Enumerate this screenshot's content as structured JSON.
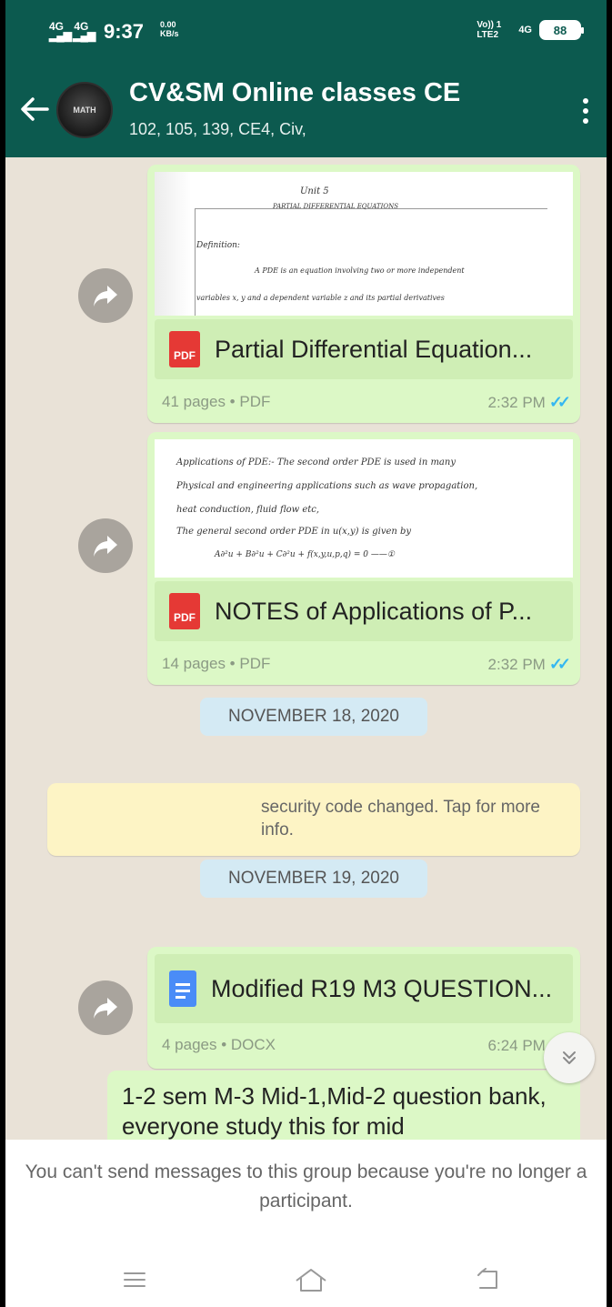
{
  "status_bar": {
    "signal_1": "4G",
    "signal_2": "4G",
    "time": "9:37",
    "speed_value": "0.00",
    "speed_unit": "KB/s",
    "volte": "Vo)) 1 LTE2",
    "network": "4G",
    "battery": "88"
  },
  "header": {
    "group_name": "CV&SM Online classes CE",
    "members": "102, 105, 139, CE4, Civ,",
    "avatar_text": "MATH",
    "icons": {
      "back": "back-arrow-icon",
      "menu": "more-vert-icon"
    }
  },
  "messages": [
    {
      "type": "document",
      "file_type_icon": "PDF",
      "preview_lines": [
        "Unit 5",
        "PARTIAL DIFFERENTIAL EQUATIONS",
        "Definition:",
        "A PDE is an equation involving two or more independent",
        "variables x, y and a dependent variable z and its partial derivatives"
      ],
      "name": "Partial Differential Equation...",
      "meta": "41 pages • PDF",
      "time": "2:32 PM"
    },
    {
      "type": "document",
      "file_type_icon": "PDF",
      "preview_lines": [
        "Applications of PDE:- The second order PDE is used in many",
        "Physical and engineering applications such as wave propagation,",
        "heat conduction, fluid flow etc,",
        "The general second order PDE in u(x,y) is given by",
        "A∂²u + B∂²u + C∂²u + f(x,y,u,p,q) = 0 ——①"
      ],
      "name": "NOTES of Applications of P...",
      "meta": "14 pages • PDF",
      "time": "2:32 PM"
    },
    {
      "type": "date",
      "label": "NOVEMBER 18, 2020"
    },
    {
      "type": "system",
      "text": "security code changed. Tap for more info."
    },
    {
      "type": "date",
      "label": "NOVEMBER 19, 2020"
    },
    {
      "type": "document",
      "file_type_icon": "DOCX",
      "name": "Modified R19 M3 QUESTION...",
      "meta": "4 pages • DOCX",
      "time": "6:24 PM"
    },
    {
      "type": "text",
      "text": "1-2 sem M-3 Mid-1,Mid-2 question bank, everyone study this for mid"
    }
  ],
  "ticks": "✓✓",
  "footer": {
    "message": "You can't send messages to this group because you're no longer a participant."
  },
  "colors": {
    "header": "#0c5a4f",
    "bubble": "#dcf8c6",
    "read_ticks": "#34b7f1",
    "system": "#fdf4c5",
    "date_pill": "#d4eaf4"
  }
}
